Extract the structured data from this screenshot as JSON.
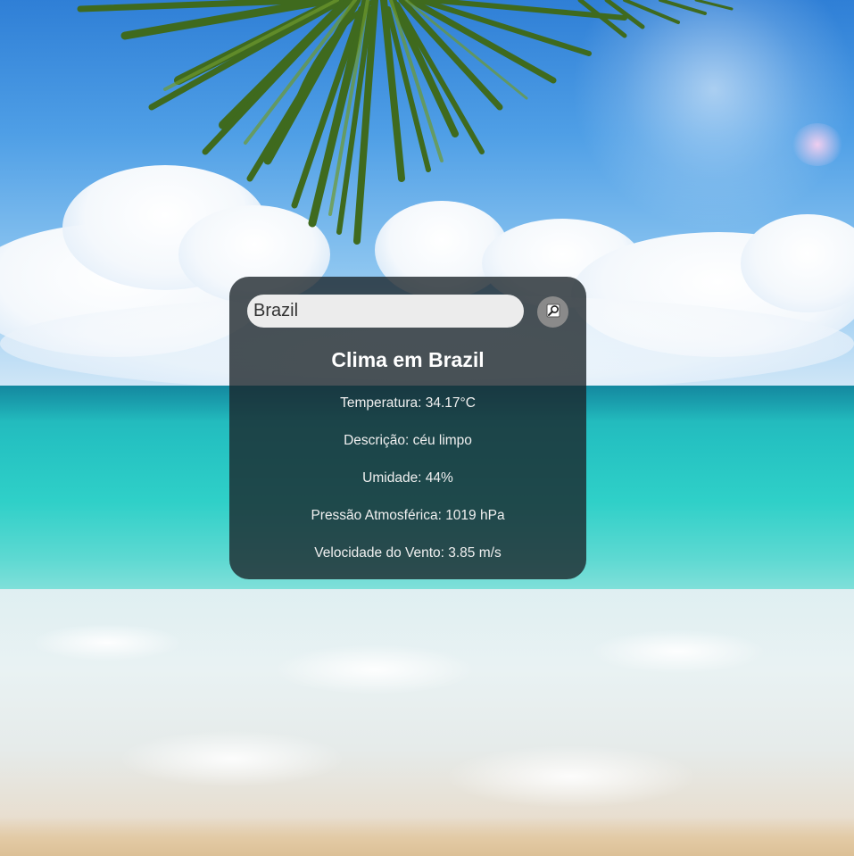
{
  "search": {
    "value": "Brazil",
    "button_icon": "search-icon"
  },
  "weather": {
    "title": "Clima em Brazil",
    "temperature": "Temperatura: 34.17°C",
    "description": "Descrição: céu limpo",
    "humidity": "Umidade: 44%",
    "pressure": "Pressão Atmosférica: 1019 hPa",
    "wind": "Velocidade do Vento: 3.85 m/s"
  },
  "colors": {
    "card_background": "#19232a",
    "input_background": "#ececec",
    "button_background": "#8a8a8a",
    "text": "#ffffff"
  }
}
